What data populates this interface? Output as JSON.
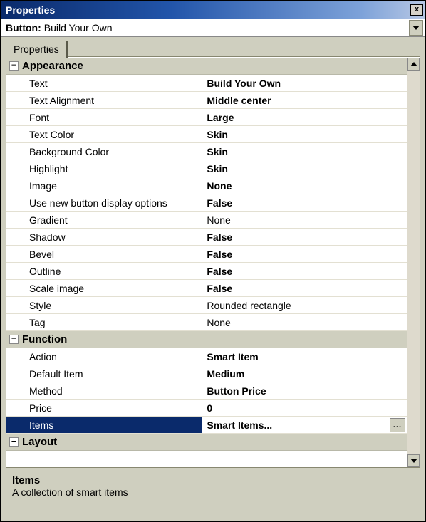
{
  "window": {
    "title": "Properties"
  },
  "selector": {
    "label": "Button:",
    "value": "Build Your Own"
  },
  "tabs": {
    "main": "Properties"
  },
  "glyph": {
    "minus": "−",
    "plus": "+",
    "ellipsis": "...",
    "close": "x"
  },
  "categories": [
    {
      "name": "Appearance",
      "expanded": true,
      "props": [
        {
          "name": "Text",
          "value": "Build Your Own",
          "bold": true
        },
        {
          "name": "Text Alignment",
          "value": "Middle center",
          "bold": true
        },
        {
          "name": "Font",
          "value": "Large",
          "bold": true
        },
        {
          "name": "Text Color",
          "value": "Skin",
          "bold": true
        },
        {
          "name": "Background Color",
          "value": "Skin",
          "bold": true
        },
        {
          "name": "Highlight",
          "value": "Skin",
          "bold": true
        },
        {
          "name": "Image",
          "value": "None",
          "bold": true
        },
        {
          "name": "Use new button display options",
          "value": "False",
          "bold": true
        },
        {
          "name": "Gradient",
          "value": "None",
          "bold": false
        },
        {
          "name": "Shadow",
          "value": "False",
          "bold": true
        },
        {
          "name": "Bevel",
          "value": "False",
          "bold": true
        },
        {
          "name": "Outline",
          "value": "False",
          "bold": true
        },
        {
          "name": "Scale image",
          "value": "False",
          "bold": true
        },
        {
          "name": "Style",
          "value": "Rounded rectangle",
          "bold": false
        },
        {
          "name": "Tag",
          "value": "None",
          "bold": false
        }
      ]
    },
    {
      "name": "Function",
      "expanded": true,
      "props": [
        {
          "name": "Action",
          "value": "Smart Item",
          "bold": true
        },
        {
          "name": "Default Item",
          "value": "Medium",
          "bold": true
        },
        {
          "name": "Method",
          "value": "Button Price",
          "bold": true
        },
        {
          "name": "Price",
          "value": "0",
          "bold": true
        },
        {
          "name": "Items",
          "value": "Smart Items...",
          "bold": true,
          "selected": true,
          "ellipsis": true
        }
      ]
    },
    {
      "name": "Layout",
      "expanded": false,
      "props": []
    }
  ],
  "description": {
    "title": "Items",
    "text": "A collection of smart items"
  }
}
